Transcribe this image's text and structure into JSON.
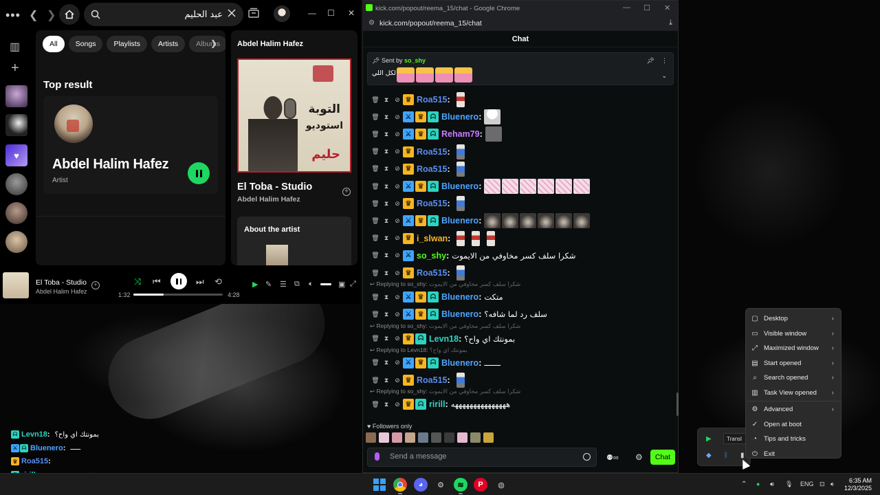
{
  "spotify": {
    "search_value": "عبد الحليم",
    "chips": [
      "All",
      "Songs",
      "Playlists",
      "Artists",
      "Albums"
    ],
    "top_result_heading": "Top result",
    "top_result": {
      "name": "Abdel Halim Hafez",
      "type": "Artist"
    },
    "now_playing_panel": {
      "header": "Abdel Halim Hafez",
      "album_title_ar_1": "التوبة",
      "album_title_ar_2": "استوديو",
      "album_signature": "حليم",
      "track_title": "El Toba - Studio",
      "track_artist": "Abdel Halim Hafez",
      "about_heading": "About the artist"
    },
    "player": {
      "title": "El Toba - Studio",
      "artist": "Abdel Halim Hafez",
      "elapsed": "1:32",
      "duration": "4:28",
      "progress": 0.34
    }
  },
  "chrome": {
    "title": "kick.com/popout/reema_15/chat - Google Chrome",
    "url": "kick.com/popout/reema_15/chat",
    "chat_header": "Chat",
    "pinned": {
      "sent_by_label": "Sent by",
      "sender": "so_shy",
      "message": "لكل اللي"
    },
    "messages": [
      {
        "user": "Roa515",
        "color": "#5b8def",
        "badges": [
          "crown"
        ],
        "text": "",
        "emotes": [
          "fig"
        ]
      },
      {
        "user": "Bluenero",
        "color": "#4da3ff",
        "badges": [
          "sword",
          "crown",
          "og"
        ],
        "text": "",
        "emotes": [
          "chef"
        ]
      },
      {
        "user": "Reham79",
        "color": "#c77dff",
        "badges": [
          "sword",
          "crown",
          "og"
        ],
        "text": "",
        "emotes": [
          "cat"
        ]
      },
      {
        "user": "Roa515",
        "color": "#5b8def",
        "badges": [
          "crown"
        ],
        "text": "",
        "emotes": [
          "blue"
        ]
      },
      {
        "user": "Roa515",
        "color": "#5b8def",
        "badges": [
          "crown"
        ],
        "text": "",
        "emotes": [
          "blue"
        ]
      },
      {
        "user": "Bluenero",
        "color": "#4da3ff",
        "badges": [
          "sword",
          "crown",
          "og"
        ],
        "text": "",
        "emotes": [
          "pink",
          "pink",
          "pink",
          "pink",
          "pink",
          "pink"
        ]
      },
      {
        "user": "Roa515",
        "color": "#5b8def",
        "badges": [
          "crown"
        ],
        "text": "",
        "emotes": [
          "blue"
        ]
      },
      {
        "user": "Bluenero",
        "color": "#4da3ff",
        "badges": [
          "sword",
          "crown",
          "og"
        ],
        "text": "",
        "emotes": [
          "tree",
          "tree",
          "tree",
          "tree",
          "tree",
          "tree"
        ]
      },
      {
        "user": "i_slwan",
        "color": "#f5b622",
        "badges": [
          "crown"
        ],
        "text": "",
        "emotes": [
          "fig",
          "fig",
          "fig"
        ]
      },
      {
        "user": "so_shy",
        "color": "#53fc18",
        "badges": [
          "sword"
        ],
        "text": "شكرا سلف كسر مخاوفي من الايموت",
        "emotes": []
      },
      {
        "user": "Roa515",
        "color": "#5b8def",
        "badges": [
          "crown"
        ],
        "text": "",
        "emotes": [
          "blue"
        ]
      },
      {
        "user": "Bluenero",
        "color": "#4da3ff",
        "badges": [
          "sword",
          "crown",
          "og"
        ],
        "text": "متكت",
        "emotes": [],
        "reply": {
          "to": "Replying to so_shy:",
          "quote": "شكرا سلف كسر مخاوفي من الايموت"
        }
      },
      {
        "user": "Bluenero",
        "color": "#4da3ff",
        "badges": [
          "sword",
          "crown",
          "og"
        ],
        "text": "سلف رد لما شافه؟",
        "emotes": []
      },
      {
        "user": "Levn18",
        "color": "#2ed3c0",
        "badges": [
          "crown",
          "og"
        ],
        "text": "بمونتك اي واح؟",
        "emotes": [],
        "reply": {
          "to": "Replying to so_shy:",
          "quote": "شكرا سلف كسر مخاوفي من الايموت"
        }
      },
      {
        "user": "Bluenero",
        "color": "#4da3ff",
        "badges": [
          "sword",
          "crown",
          "og"
        ],
        "text": "ـــــــ",
        "emotes": [],
        "reply": {
          "to": "Replying to Levn18:",
          "quote": "بمونتك اي واح؟"
        }
      },
      {
        "user": "Roa515",
        "color": "#5b8def",
        "badges": [
          "crown"
        ],
        "text": "",
        "emotes": [
          "blue"
        ]
      },
      {
        "user": "ririll",
        "color": "#2ed3c0",
        "badges": [
          "crown",
          "og"
        ],
        "text": "هههههههههههههههه",
        "emotes": [],
        "reply": {
          "to": "Replying to so_shy:",
          "quote": "شكرا سلف كسر مخاوفي من الايموت"
        }
      }
    ],
    "followers_only": "Followers only",
    "send_placeholder": "Send a message",
    "chat_button": "Chat"
  },
  "overlay_chat": [
    {
      "user": "Levn18",
      "color": "#2ed3c0",
      "badges": [
        "og"
      ],
      "text": "بمونتك اي واح؟"
    },
    {
      "user": "Bluenero",
      "color": "#4da3ff",
      "badges": [
        "sword",
        "og"
      ],
      "text": "ـــــ"
    },
    {
      "user": "Roa515",
      "color": "#5b8def",
      "badges": [
        "crown"
      ],
      "text": ""
    },
    {
      "user": "ririll",
      "color": "#2ed3c0",
      "badges": [
        "og"
      ],
      "text": "هههههههههههههههه"
    }
  ],
  "context_menu": {
    "items": [
      {
        "label": "Desktop",
        "icon": "▢",
        "submenu": true
      },
      {
        "label": "Visible window",
        "icon": "▭",
        "submenu": true
      },
      {
        "label": "Maximized window",
        "icon": "⤢",
        "submenu": true
      },
      {
        "label": "Start opened",
        "icon": "▤",
        "submenu": true
      },
      {
        "label": "Search opened",
        "icon": "⌕",
        "submenu": true
      },
      {
        "label": "Task View opened",
        "icon": "▥",
        "submenu": true
      },
      {
        "label": "Advanced",
        "icon": "⚙",
        "submenu": true
      },
      {
        "label": "Open at boot",
        "icon": "✓",
        "submenu": false
      },
      {
        "label": "Tips and tricks",
        "icon": "◔",
        "submenu": false
      },
      {
        "label": "Exit",
        "icon": "⏻",
        "submenu": false
      }
    ]
  },
  "tray": {
    "tooltip": "Transl",
    "language": "ENG"
  },
  "clock": {
    "time": "6:35 AM",
    "date": "12/3/2025"
  }
}
